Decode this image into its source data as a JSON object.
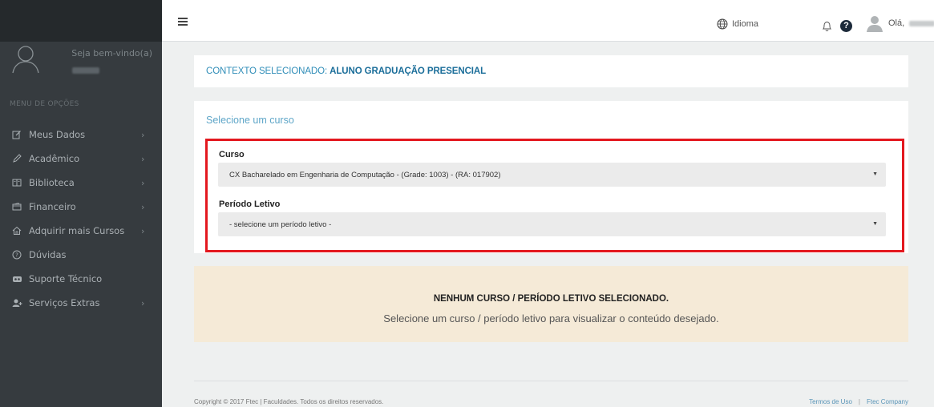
{
  "sidebar": {
    "welcome": "Seja bem-vindo(a)",
    "menu_heading": "MENU DE OPÇÕES",
    "items": [
      {
        "label": "Meus Dados",
        "icon": "edit-icon",
        "has_children": true
      },
      {
        "label": "Acadêmico",
        "icon": "pencil-icon",
        "has_children": true
      },
      {
        "label": "Biblioteca",
        "icon": "book-icon",
        "has_children": true
      },
      {
        "label": "Financeiro",
        "icon": "wallet-icon",
        "has_children": true
      },
      {
        "label": "Adquirir mais Cursos",
        "icon": "home-icon",
        "has_children": true
      },
      {
        "label": "Dúvidas",
        "icon": "question-circle-icon",
        "has_children": false
      },
      {
        "label": "Suporte Técnico",
        "icon": "headset-icon",
        "has_children": false
      },
      {
        "label": "Serviços Extras",
        "icon": "user-plus-icon",
        "has_children": true
      }
    ]
  },
  "topbar": {
    "language_label": "Idioma",
    "greeting": "Olá,"
  },
  "context": {
    "prefix": "CONTEXTO SELECIONADO:",
    "value": "ALUNO GRADUAÇÃO PRESENCIAL"
  },
  "course_select": {
    "title": "Selecione um curso",
    "course_label": "Curso",
    "course_value": "CX Bacharelado em Engenharia de Computação - (Grade: 1003) - (RA: 017902)",
    "period_label": "Período Letivo",
    "period_value": "- selecione um período letivo -"
  },
  "empty_state": {
    "title": "NENHUM CURSO / PERÍODO LETIVO SELECIONADO.",
    "message": "Selecione um curso / período letivo para visualizar o conteúdo desejado."
  },
  "footer": {
    "copyright": "Copyright © 2017 Ftec | Faculdades. Todos os direitos reservados.",
    "terms_link": "Termos de Uso",
    "company_link": "Ftec Company"
  },
  "colors": {
    "sidebar_bg": "#363b3f",
    "accent_blue": "#2f8db8",
    "highlight_red": "#e3181f",
    "empty_bg": "#f5ead7"
  }
}
